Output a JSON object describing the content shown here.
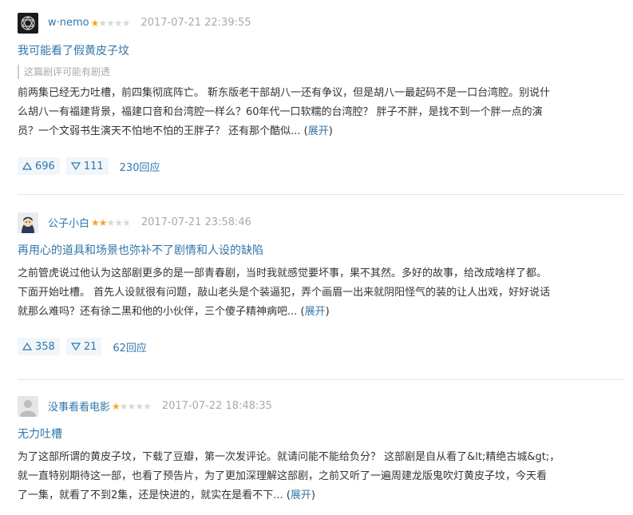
{
  "reviews": [
    {
      "author": "w·nemo",
      "rating": 1,
      "time": "2017-07-21 22:39:55",
      "title": "我可能看了假黄皮子坟",
      "spoiler": "这篇剧评可能有剧透",
      "lines": [
        "前两集已经无力吐槽，前四集彻底阵亡。 靳东版老干部胡八一还有争议，但是胡八一最起码不是一口台湾腔。别说什",
        "么胡八一有福建背景，福建口音和台湾腔一样么？60年代一口软糯的台湾腔？ 胖子不胖，是找不到一个胖一点的演",
        "员？一个文弱书生演天不怕地不怕的王胖子？ 还有那个酷似..."
      ],
      "expand": "展开",
      "useful": "696",
      "useless": "111",
      "replies": "230回应"
    },
    {
      "author": "公子小白",
      "rating": 2,
      "time": "2017-07-21 23:58:46",
      "title": "再用心的道具和场景也弥补不了剧情和人设的缺陷",
      "spoiler": "",
      "lines": [
        "之前管虎说过他认为这部剧更多的是一部青春剧，当时我就感觉要坏事，果不其然。多好的故事，给改成啥样了都。",
        "下面开始吐槽。 首先人设就很有问题，敲山老头是个装逼犯，弄个画眉一出来就阴阳怪气的装的让人出戏，好好说话",
        "就那么难吗？还有徐二黑和他的小伙伴，三个傻子精神病吧..."
      ],
      "expand": "展开",
      "useful": "358",
      "useless": "21",
      "replies": "62回应"
    },
    {
      "author": "没事看看电影",
      "rating": 1,
      "time": "2017-07-22 18:48:35",
      "title": "无力吐槽",
      "spoiler": "",
      "lines": [
        "为了这部所谓的黄皮子坟，下载了豆瓣，第一次发评论。就请问能不能给负分？ 这部剧是自从看了&lt;精绝古城&gt;，",
        "就一直特别期待这一部，也看了预告片，为了更加深理解这部剧，之前又听了一遍周建龙版鬼吹灯黄皮子坟，今天看",
        "了一集，就看了不到2集，还是快进的，就实在是看不下..."
      ],
      "expand": "展开",
      "useful": "",
      "useless": "",
      "replies": ""
    }
  ],
  "colors": {
    "link": "#3377aa",
    "star": "#f5a623",
    "muted": "#aaaaaa",
    "vote_bg": "#f0f6fa"
  },
  "icons": {
    "up": "triangle-up-icon",
    "down": "triangle-down-icon"
  }
}
